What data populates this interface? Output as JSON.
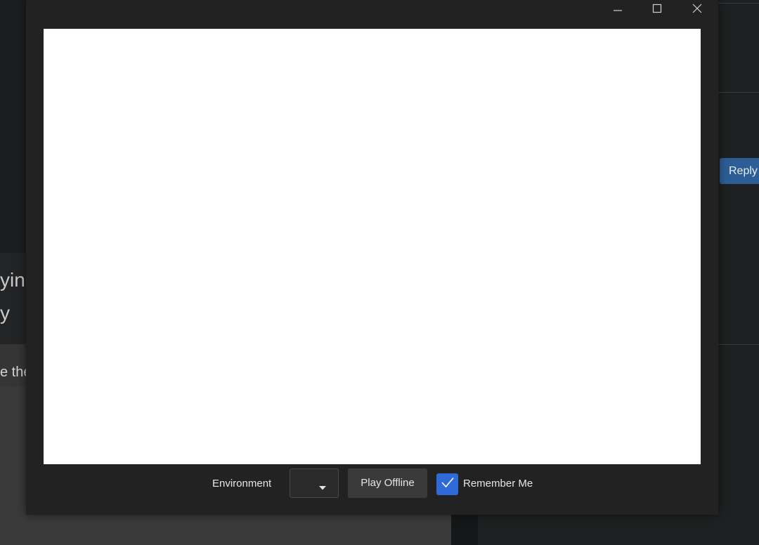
{
  "background_page": {
    "reply_button_label": "Reply",
    "fragment_1": "yin",
    "fragment_2": "y",
    "fragment_3": "e the"
  },
  "dialog": {
    "window_controls": {
      "minimize_icon": "minimize-icon",
      "maximize_icon": "maximize-icon",
      "close_icon": "close-icon"
    },
    "footer": {
      "environment_label": "Environment",
      "environment_selected": "",
      "play_offline_label": "Play Offline",
      "remember_me_label": "Remember Me",
      "remember_me_checked": true
    }
  },
  "colors": {
    "checkbox_accent": "#2f6bd8",
    "reply_button": "#2c5d94",
    "dialog_bg": "#222223",
    "webview_bg": "#ffffff"
  }
}
